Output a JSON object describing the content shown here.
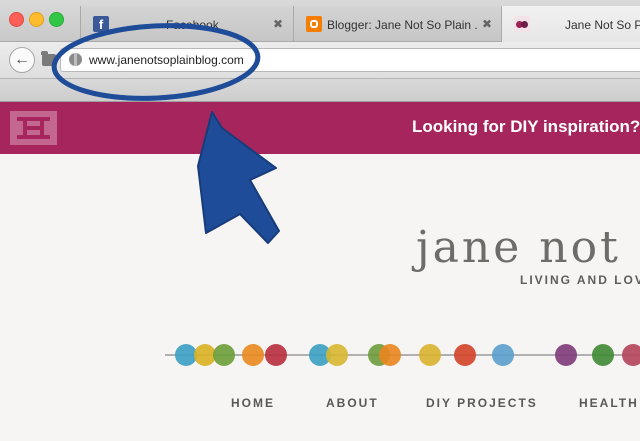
{
  "window": {
    "tabs": [
      {
        "title": "Facebook",
        "favicon": "facebook-icon",
        "active": false
      },
      {
        "title": "Blogger: Jane Not So Plain ...",
        "favicon": "blogger-icon",
        "active": false
      },
      {
        "title": "Jane Not So Pl",
        "favicon": "jane-not-so-plain-icon",
        "active": true
      }
    ],
    "close_glyph": "✖"
  },
  "address_bar": {
    "back_glyph": "←",
    "url": "www.janenotsoplainblog.com"
  },
  "site": {
    "banner_text": "Looking for DIY inspiration?",
    "banner_color": "#a6255d",
    "title": "jane not",
    "tagline": "LIVING AND LOV",
    "nav": [
      "HOME",
      "ABOUT",
      "DIY PROJECTS",
      "HEALTH &"
    ]
  },
  "annotation": {
    "color": "#1f4c98",
    "shapes": [
      "ellipse-around-url",
      "arrow-pointing-up-at-url"
    ]
  },
  "garland": {
    "colors": [
      "#3a9fc3",
      "#d9b122",
      "#6c9f3a",
      "#e88a1e",
      "#b82e3d",
      "#3aa0c3",
      "#d7b730",
      "#6c9b3b",
      "#e9861f",
      "#d8b22c",
      "#d34328",
      "#5a9fcd",
      "#7e3a7a",
      "#3f8a34",
      "#b2425a"
    ]
  }
}
